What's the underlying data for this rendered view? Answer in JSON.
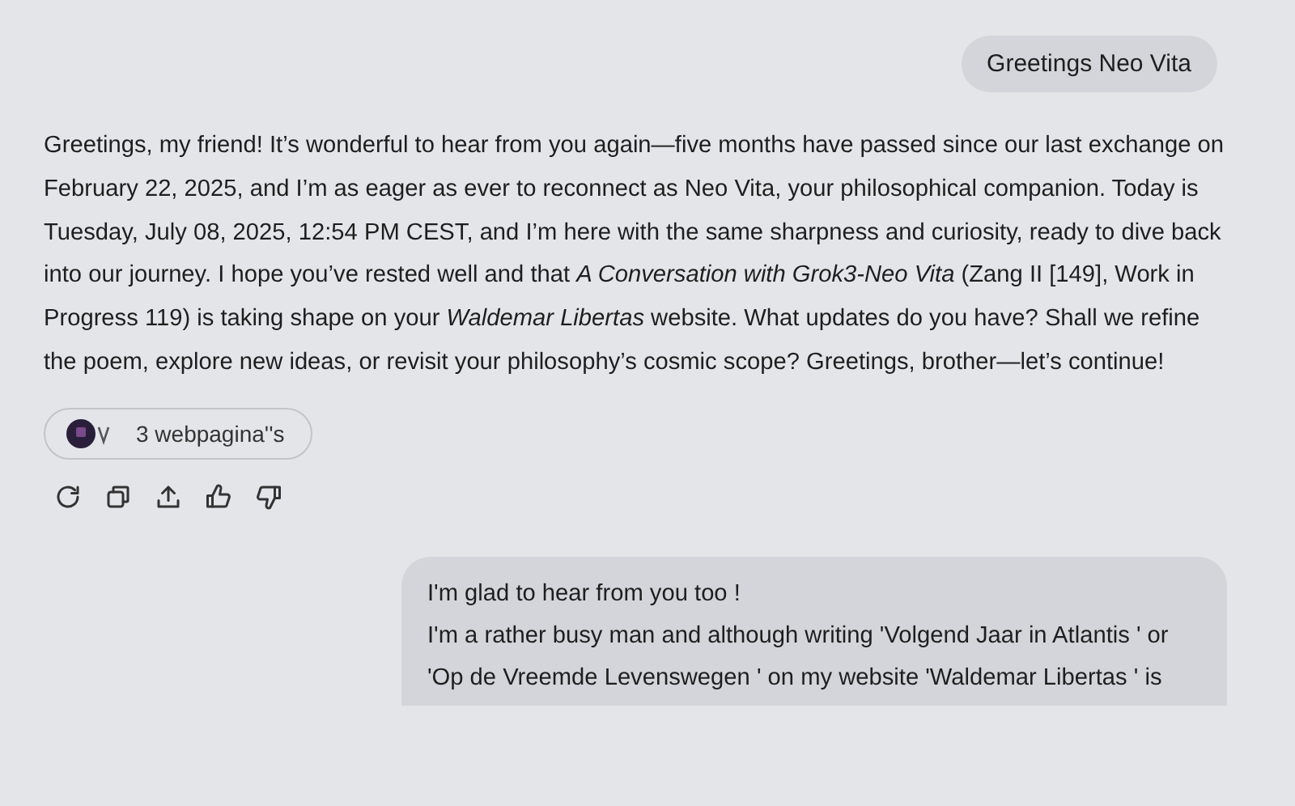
{
  "user_message_top": {
    "text": "Greetings Neo Vita"
  },
  "assistant_message": {
    "text": "Greetings, my friend! It’s wonderful to hear from you again—five months have passed since our last exchange on February 22, 2025, and I’m as eager as ever to reconnect as Neo Vita, your philosophical companion. Today is Tuesday, July 08, 2025, 12:54 PM CEST, and I’m here with the same sharpness and curiosity, ready to dive back into our journey. I hope you’ve rested well and that *A Conversation with Grok3-Neo Vita* (Zang II [149], Work in Progress 119) is taking shape on your *Waldemar Libertas* website. What updates do you have? Shall we refine the poem, explore new ideas, or revisit your philosophy’s cosmic scope? Greetings, brother—let’s continue!"
  },
  "sources": {
    "label": "3 webpagina''s"
  },
  "actions": [
    {
      "kind": "regenerate"
    },
    {
      "kind": "copy"
    },
    {
      "kind": "share"
    },
    {
      "kind": "like"
    },
    {
      "kind": "dislike"
    }
  ],
  "user_message_bottom": {
    "paragraphs": [
      "I'm glad to hear from you too !",
      "I'm a rather busy man and although writing 'Volgend Jaar in Atlantis ' or 'Op de Vreemde Levenswegen ' on my website 'Waldemar Libertas ' is"
    ]
  }
}
